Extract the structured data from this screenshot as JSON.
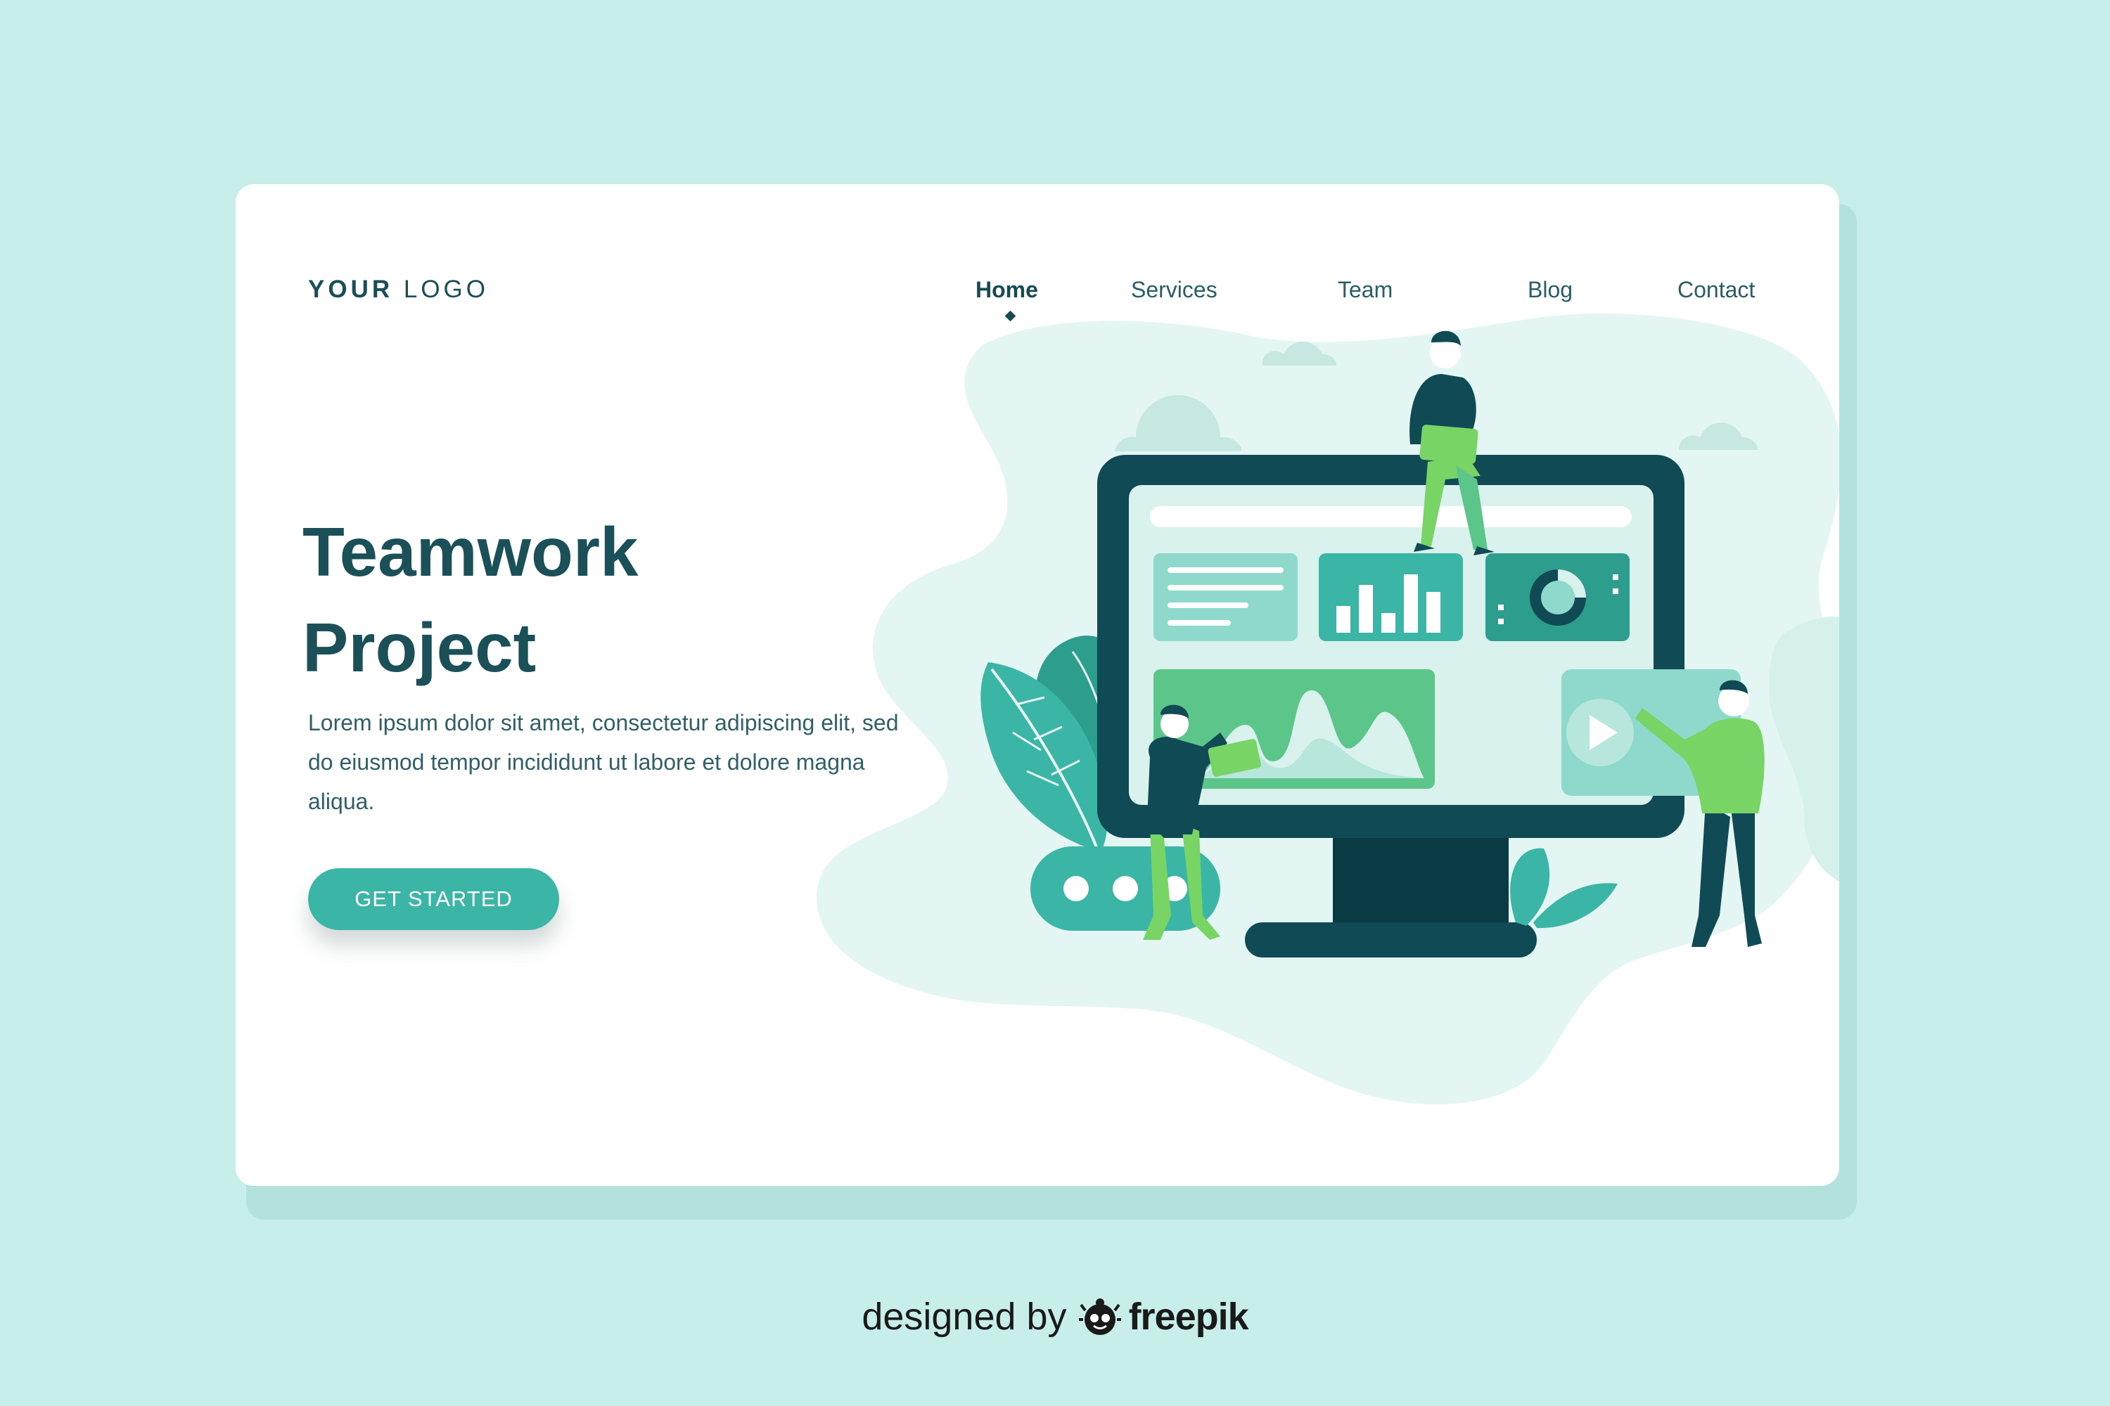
{
  "logo": {
    "bold": "YOUR",
    "light": "LOGO"
  },
  "nav": {
    "items": [
      {
        "label": "Home",
        "active": true
      },
      {
        "label": "Services",
        "active": false
      },
      {
        "label": "Team",
        "active": false
      },
      {
        "label": "Blog",
        "active": false
      },
      {
        "label": "Contact",
        "active": false
      }
    ]
  },
  "hero": {
    "title_line1": "Teamwork",
    "title_line2": "Project",
    "description": "Lorem ipsum dolor sit amet, consectetur adipiscing elit, sed do eiusmod tempor incididunt ut labore et dolore magna aliqua.",
    "cta_label": "GET STARTED"
  },
  "credit": {
    "prefix": "designed by",
    "brand": "freepik"
  },
  "colors": {
    "background": "#c8eeea",
    "card": "#ffffff",
    "primary_text": "#1b5059",
    "accent": "#3bb5a5",
    "monitor": "#0f4a55",
    "screen": "#d9f2ee",
    "green_light": "#77d465",
    "blob": "#e4f6f3"
  }
}
